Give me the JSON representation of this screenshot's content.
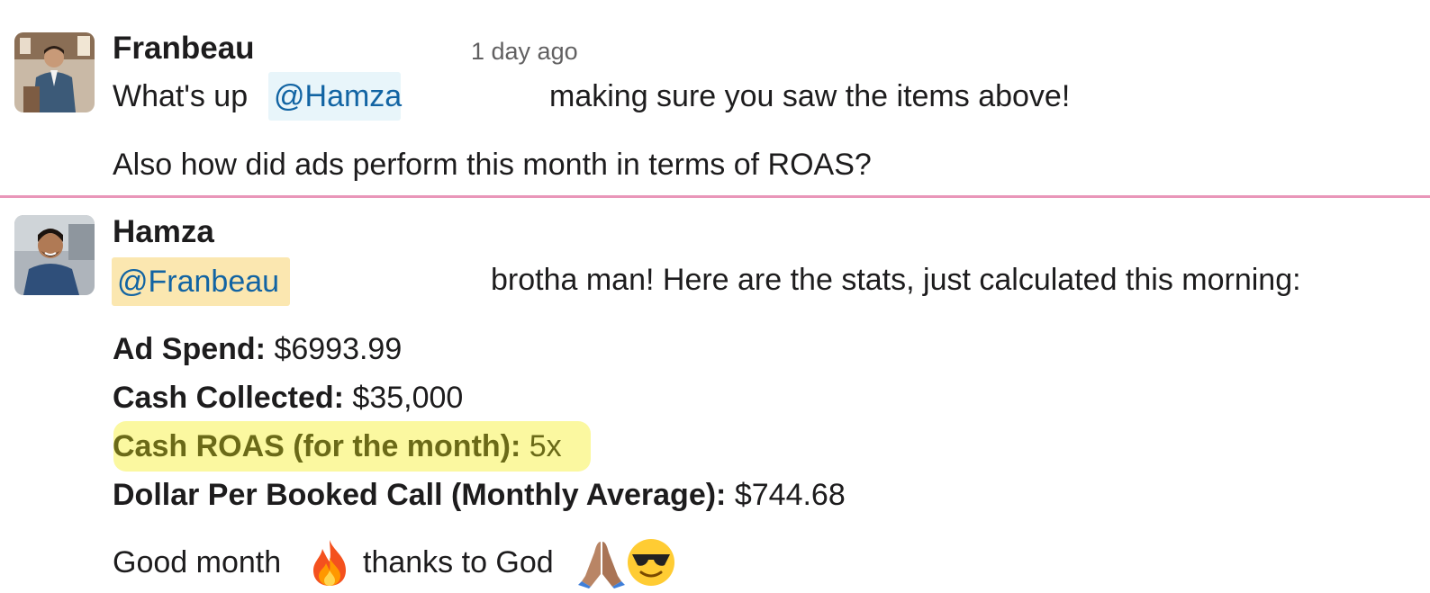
{
  "messages": [
    {
      "sender": "Franbeau",
      "timestamp": "1 day ago",
      "avatar_icon": "person-avatar-suit",
      "line1_prefix": "What's up",
      "mention": "@Hamza",
      "line1_suffix": "making sure you saw the items above!",
      "line2": "Also how did ads perform this month in terms of ROAS?"
    },
    {
      "sender": "Hamza",
      "avatar_icon": "person-avatar-smiling",
      "mention": "@Franbeau",
      "line1_suffix": "brotha man! Here are the stats, just calculated this morning:",
      "stats": [
        {
          "label": "Ad Spend:",
          "value": "$6993.99"
        },
        {
          "label": "Cash Collected:",
          "value": "$35,000"
        },
        {
          "label": "Cash ROAS (for the month):",
          "value": "5x"
        },
        {
          "label": "Dollar Per Booked Call (Monthly Average):",
          "value": "$744.68"
        }
      ],
      "closing_part1": "Good month",
      "closing_emoji1": "fire-emoji",
      "closing_part2": "thanks to God",
      "closing_emoji2": "folded-hands-emoji",
      "closing_emoji3": "sunglasses-emoji"
    }
  ],
  "colors": {
    "mention_text": "#1264a3",
    "mention_bg_blue": "#e8f5fa",
    "mention_bg_yellow": "#fbe7b0",
    "unread_divider": "#e996b9",
    "roas_highlight": "#fbf8a0"
  }
}
